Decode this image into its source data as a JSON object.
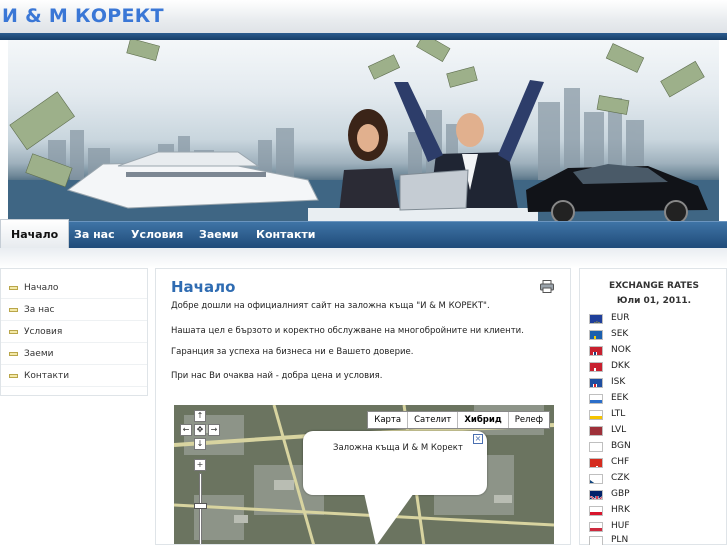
{
  "site": {
    "title": "И & М КОРЕКТ"
  },
  "nav": {
    "items": [
      {
        "label": "Начало",
        "active": true
      },
      {
        "label": "За нас",
        "active": false
      },
      {
        "label": "Условия",
        "active": false
      },
      {
        "label": "Заеми",
        "active": false
      },
      {
        "label": "Контакти",
        "active": false
      }
    ]
  },
  "left_menu": {
    "items": [
      {
        "label": "Начало"
      },
      {
        "label": "За нас"
      },
      {
        "label": "Условия"
      },
      {
        "label": "Заеми"
      },
      {
        "label": "Контакти"
      }
    ]
  },
  "main": {
    "title": "Начало",
    "paragraphs": [
      "Добре дошли на официалният сайт на заложна къща \"И & М КОРЕКТ\".",
      "Нашата цел е бързото и коректно обслужване на многобройните ни клиенти.",
      "Гаранция за успеха на бизнеса ни е Вашето доверие.",
      "При нас Ви очаква най - добра цена и условия."
    ],
    "map": {
      "types": [
        {
          "label": "Карта",
          "active": false
        },
        {
          "label": "Сателит",
          "active": false
        },
        {
          "label": "Хибрид",
          "active": true
        },
        {
          "label": "Релеф",
          "active": false
        }
      ],
      "bubble_text": "Заложна къща И & М Корект"
    }
  },
  "rates": {
    "title": "EXCHANGE RATES",
    "date": "Юли 01, 2011.",
    "currencies": [
      {
        "code": "EUR",
        "flag": "eu-flag-icon"
      },
      {
        "code": "SEK",
        "flag": "sweden-flag-icon"
      },
      {
        "code": "NOK",
        "flag": "norway-flag-icon"
      },
      {
        "code": "DKK",
        "flag": "denmark-flag-icon"
      },
      {
        "code": "ISK",
        "flag": "iceland-flag-icon"
      },
      {
        "code": "EEK",
        "flag": "estonia-flag-icon"
      },
      {
        "code": "LTL",
        "flag": "lithuania-flag-icon"
      },
      {
        "code": "LVL",
        "flag": "latvia-flag-icon"
      },
      {
        "code": "BGN",
        "flag": "bulgaria-flag-icon"
      },
      {
        "code": "CHF",
        "flag": "switzerland-flag-icon"
      },
      {
        "code": "CZK",
        "flag": "czech-flag-icon"
      },
      {
        "code": "GBP",
        "flag": "uk-flag-icon"
      },
      {
        "code": "HRK",
        "flag": "croatia-flag-icon"
      },
      {
        "code": "HUF",
        "flag": "hungary-flag-icon"
      },
      {
        "code": "PLN",
        "flag": "poland-flag-icon"
      }
    ]
  },
  "colors": {
    "brand_blue": "#3a77d6",
    "nav_blue": "#1f4b79",
    "heading_blue": "#2f6cb2"
  }
}
